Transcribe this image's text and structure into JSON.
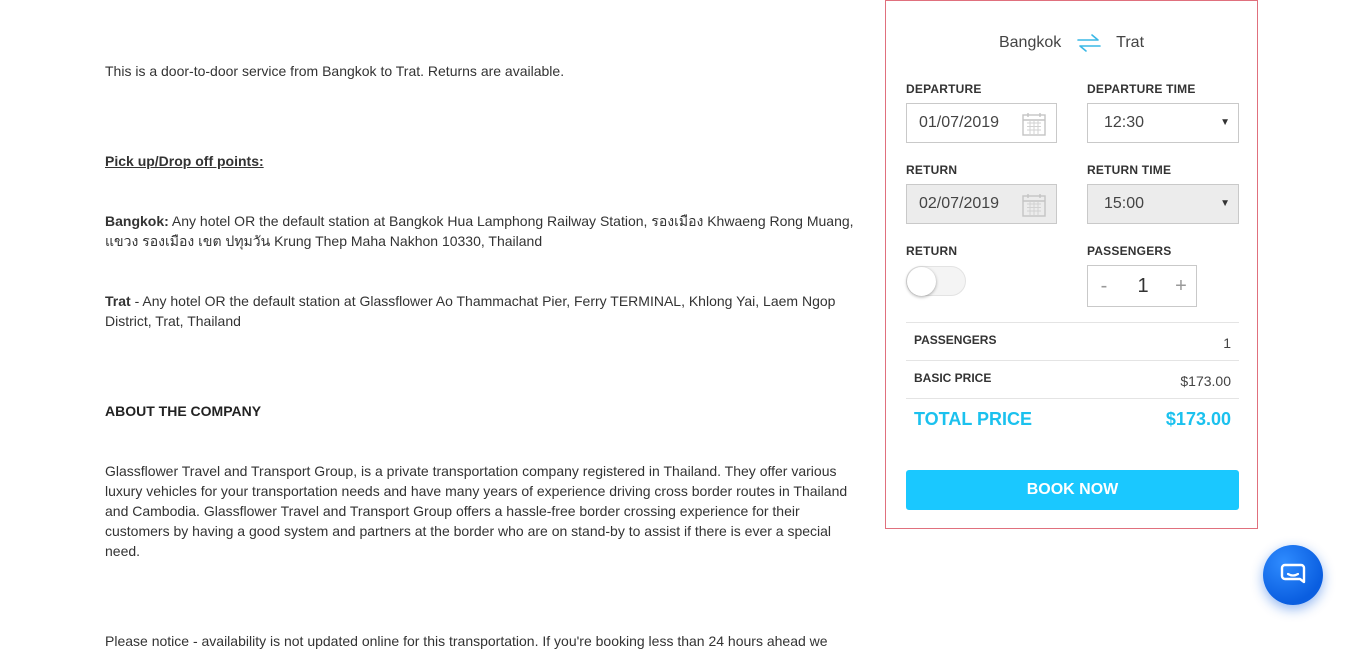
{
  "content": {
    "intro": "This is a door-to-door service from Bangkok to Trat. Returns are available.",
    "pickup_title": "Pick up/Drop off points:",
    "bangkok_label": "Bangkok:",
    "bangkok_text": " Any hotel OR the default station at Bangkok Hua Lamphong Railway Station, รองเมือง Khwaeng Rong Muang, แขวง รองเมือง เขต ปทุมวัน Krung Thep Maha Nakhon 10330, Thailand",
    "trat_label": "Trat",
    "trat_text": " - Any hotel OR the default station at Glassflower Ao Thammachat Pier, Ferry TERMINAL, Khlong Yai, Laem Ngop District, Trat, Thailand",
    "about_title": "ABOUT THE COMPANY",
    "about_text": "Glassflower Travel and Transport Group, is a private transportation company registered in Thailand. They offer various luxury vehicles for your transportation needs and have many years of experience driving cross border routes in Thailand and Cambodia. Glassflower Travel and Transport Group offers a hassle-free border crossing experience for their customers by having a good system and partners at the border who are on stand-by to assist if there is ever a special need.",
    "notice_text": "Please notice - availability is not updated online for this transportation. If you're booking less than 24 hours ahead we"
  },
  "booking": {
    "from_city": "Bangkok",
    "to_city": "Trat",
    "departure_label": "DEPARTURE",
    "departure_date": "01/07/2019",
    "departure_time_label": "DEPARTURE TIME",
    "departure_time": "12:30",
    "return_label": "RETURN",
    "return_date": "02/07/2019",
    "return_time_label": "RETURN TIME",
    "return_time": "15:00",
    "return_toggle_label": "RETURN",
    "return_toggle_on": false,
    "passengers_label": "PASSENGERS",
    "minus": "-",
    "passenger_count": "1",
    "plus": "+",
    "summary": {
      "passengers_label": "PASSENGERS",
      "passengers_value": "1",
      "basic_price_label": "BASIC PRICE",
      "basic_price_value": "$173.00",
      "total_label": "TOTAL PRICE",
      "total_value": "$173.00"
    },
    "book_label": "BOOK NOW"
  },
  "colors": {
    "accent": "#1ac8ff",
    "panel_border": "#e0707d",
    "chat": "#0a5ee0"
  },
  "icons": {
    "swap": "swap-arrows-icon",
    "calendar": "calendar-icon",
    "chat": "chat-bubble-icon"
  }
}
